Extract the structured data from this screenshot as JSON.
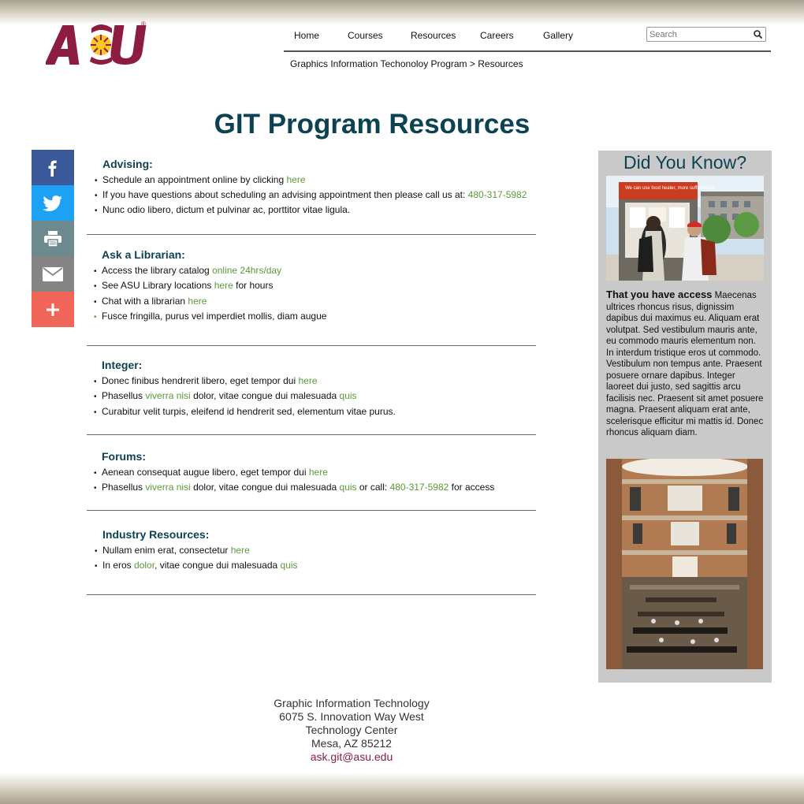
{
  "logo": {
    "text": "ASU",
    "trademark": "®"
  },
  "nav": {
    "items": [
      "Home",
      "Courses",
      "Resources",
      "Careers",
      "Gallery"
    ],
    "search_placeholder": "Search"
  },
  "breadcrumb": "Graphics Information Techonoloy Program > Resources",
  "page_title": "GIT Program Resources",
  "share": [
    "facebook",
    "twitter",
    "print",
    "email",
    "more"
  ],
  "sections": {
    "advising": {
      "title": "Advising:",
      "l1": {
        "t": "Schedule an appointment online by clicking ",
        "link": "here"
      },
      "l2": {
        "t": "If you have questions about scheduling an advising appointment then please call us at: ",
        "link": "480-317-5982"
      },
      "l3": {
        "t": "Nunc odio libero, dictum et pulvinar ac, porttitor vitae ligula."
      }
    },
    "librarian": {
      "title": "Ask a Librarian:",
      "l1": {
        "t": "Access the library catalog ",
        "link": "online 24hrs/day"
      },
      "l2": {
        "t": "See ASU Library locations ",
        "link": "here",
        "t2": " for hours"
      },
      "l3": {
        "t": "Chat with a librarian ",
        "link": "here"
      },
      "l4": {
        "t": "Fusce fringilla, purus vel imperdiet mollis, diam augue"
      }
    },
    "integer": {
      "title": "Integer:",
      "l1": {
        "t": "Donec finibus hendrerit libero, eget tempor dui ",
        "link": "here"
      },
      "l2": {
        "t": "Phasellus ",
        "link": "viverra nisi",
        "t2": " dolor, vitae congue dui malesuada ",
        "link2": "quis"
      },
      "l3": {
        "t": "Curabitur velit turpis, eleifend id hendrerit sed, elementum vitae purus."
      }
    },
    "forums": {
      "title": "Forums:",
      "l1": {
        "t": "Aenean consequat augue libero, eget tempor dui ",
        "link": "here"
      },
      "l2": {
        "t": "Phasellus ",
        "link": "viverra nisi",
        "t2": " dolor, vitae congue dui malesuada ",
        "link2": "quis",
        "t3": " or call: ",
        "link3": "480-317-5982",
        "t4": " for access"
      }
    },
    "industry": {
      "title": "Industry Resources:",
      "l1": {
        "t": "Nullam enim erat, consectetur ",
        "link": "here"
      },
      "l2": {
        "t": "In eros ",
        "link": "dolor",
        "t2": ", vitae congue dui malesuada ",
        "link2": "quis"
      }
    }
  },
  "sidebar": {
    "title": "Did You Know?",
    "img1_sign": "We can use food heater, more sufficient for...",
    "lead": "That you have access",
    "body": " Maecenas ultrices rhoncus risus, dignissim dapibus dui maximus eu. Aliquam erat volutpat. Sed vestibulum mauris ante, eu commodo mauris elementum non. In interdum tristique eros ut commodo. Vestibulum non tempus ante. Praesent posuere ornare dapibus. Integer laoreet dui justo, sed sagittis arcu facilisis nec. Praesent sit amet posuere magna. Praesent aliquam erat ante, scelerisque efficitur mi mattis id. Donec rhoncus aliquam diam."
  },
  "footer": {
    "line1": "Graphic Information Technology",
    "line2": "6075 S. Innovation Way West",
    "line3": "Technology Center",
    "line4": "Mesa, AZ 85212",
    "email": "ask.git@asu.edu"
  },
  "colors": {
    "maroon": "#8c1d40",
    "gold": "#ffc627",
    "heading_teal": "#0d4252",
    "link_green": "#5a9a3a",
    "facebook": "#3b5998",
    "twitter": "#1da1f2",
    "print": "#6d8a8f",
    "email": "#848484",
    "more": "#f0675a",
    "sidebar_bg": "#c9c9c9"
  }
}
